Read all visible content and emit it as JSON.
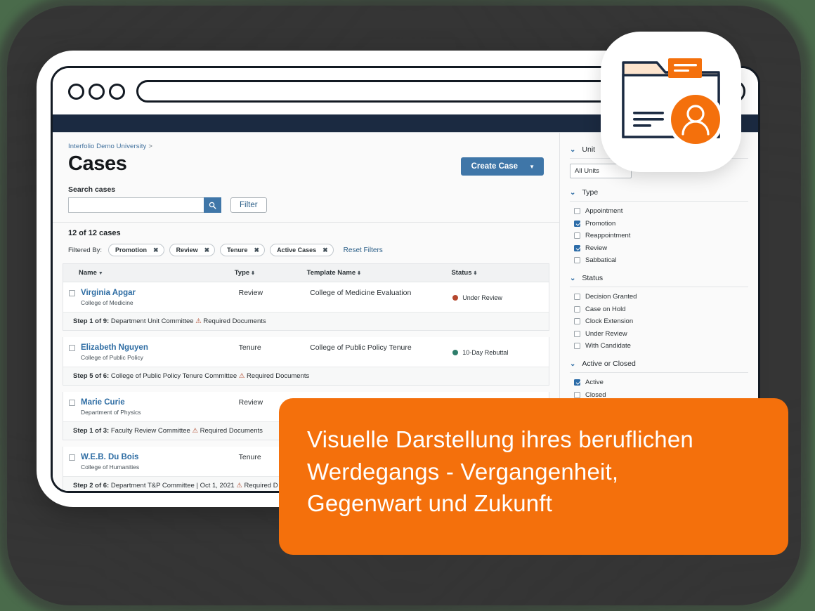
{
  "background": {
    "outer_color": "#4a6b4b",
    "blob_color": "#353535"
  },
  "browser": {
    "traffic_lights": [
      "circle-1",
      "circle-2",
      "circle-3"
    ],
    "url_bar_value": ""
  },
  "app": {
    "navy_bar_color": "#1b2a41",
    "breadcrumb": {
      "label": "Interfolio Demo University",
      "separator": ">"
    },
    "page_title": "Cases",
    "create_case": {
      "label": "Create Case",
      "chevron": "▼",
      "color": "#3f76a8"
    },
    "search": {
      "label": "Search cases",
      "value": "",
      "placeholder": "",
      "button_icon": "search-icon"
    },
    "filter_button": {
      "label": "Filter"
    },
    "case_count": "12 of 12 cases",
    "filtered_by_label": "Filtered By:",
    "filter_chips": [
      {
        "label": "Promotion",
        "remove_icon": "✖"
      },
      {
        "label": "Review",
        "remove_icon": "✖"
      },
      {
        "label": "Tenure",
        "remove_icon": "✖"
      },
      {
        "label": "Active Cases",
        "remove_icon": "✖"
      }
    ],
    "reset_filters": "Reset Filters",
    "table": {
      "columns": [
        {
          "label": "Name",
          "sort": "▼"
        },
        {
          "label": "Type",
          "sort": "⬍"
        },
        {
          "label": "Template Name",
          "sort": "⬍"
        },
        {
          "label": "Status",
          "sort": "⬍"
        }
      ],
      "rows": [
        {
          "name": "Virginia Apgar",
          "org": "College of Medicine",
          "type": "Review",
          "template": "College of Medicine Evaluation",
          "status": "Under Review",
          "status_color": "#b5472e",
          "step_prefix": "Step 1 of 9:",
          "step_text": "Department Unit Committee",
          "step_date": "",
          "warning": "Required Documents"
        },
        {
          "name": "Elizabeth Nguyen",
          "org": "College of Public Policy",
          "type": "Tenure",
          "template": "College of Public Policy Tenure",
          "status": "10-Day Rebuttal",
          "status_color": "#2e7d6b",
          "step_prefix": "Step 5 of 6:",
          "step_text": "College of Public Policy Tenure Committee",
          "step_date": "",
          "warning": "Required Documents"
        },
        {
          "name": "Marie Curie",
          "org": "Department of Physics",
          "type": "Review",
          "template": "",
          "status": "",
          "status_color": "",
          "step_prefix": "Step 1 of 3:",
          "step_text": "Faculty Review Committee",
          "step_date": "",
          "warning": "Required Documents"
        },
        {
          "name": "W.E.B. Du Bois",
          "org": "College of Humanities",
          "type": "Tenure",
          "template": "",
          "status": "",
          "status_color": "",
          "step_prefix": "Step 2 of 6:",
          "step_text": "Department T&P Committee |",
          "step_date": "Oct 1, 2021",
          "warning": "Required D"
        }
      ]
    },
    "sidebar": {
      "groups": [
        {
          "title": "Unit",
          "chevron": "⌄",
          "select_value": "All Units",
          "options": []
        },
        {
          "title": "Type",
          "chevron": "⌄",
          "options": [
            {
              "label": "Appointment",
              "checked": false
            },
            {
              "label": "Promotion",
              "checked": true
            },
            {
              "label": "Reappointment",
              "checked": false
            },
            {
              "label": "Review",
              "checked": true
            },
            {
              "label": "Sabbatical",
              "checked": false
            }
          ]
        },
        {
          "title": "Status",
          "chevron": "⌄",
          "options": [
            {
              "label": "Decision Granted",
              "checked": false
            },
            {
              "label": "Case on Hold",
              "checked": false
            },
            {
              "label": "Clock Extension",
              "checked": false
            },
            {
              "label": "Under Review",
              "checked": false
            },
            {
              "label": "With Candidate",
              "checked": false
            }
          ]
        },
        {
          "title": "Active or Closed",
          "chevron": "⌄",
          "options": [
            {
              "label": "Active",
              "checked": true
            },
            {
              "label": "Closed",
              "checked": false
            }
          ]
        }
      ]
    }
  },
  "badge": {
    "icon_name": "folder-with-person-icon",
    "folder_outline_color": "#1b2a41",
    "folder_tab_fill": "#fde4cd",
    "note_color": "#f4700c",
    "avatar_color": "#f4700c"
  },
  "caption": {
    "background_color": "#f4700c",
    "lines": [
      "Visuelle Darstellung ihres beruflichen",
      "Werdegangs - Vergangenheit,",
      "Gegenwart und Zukunft"
    ]
  }
}
